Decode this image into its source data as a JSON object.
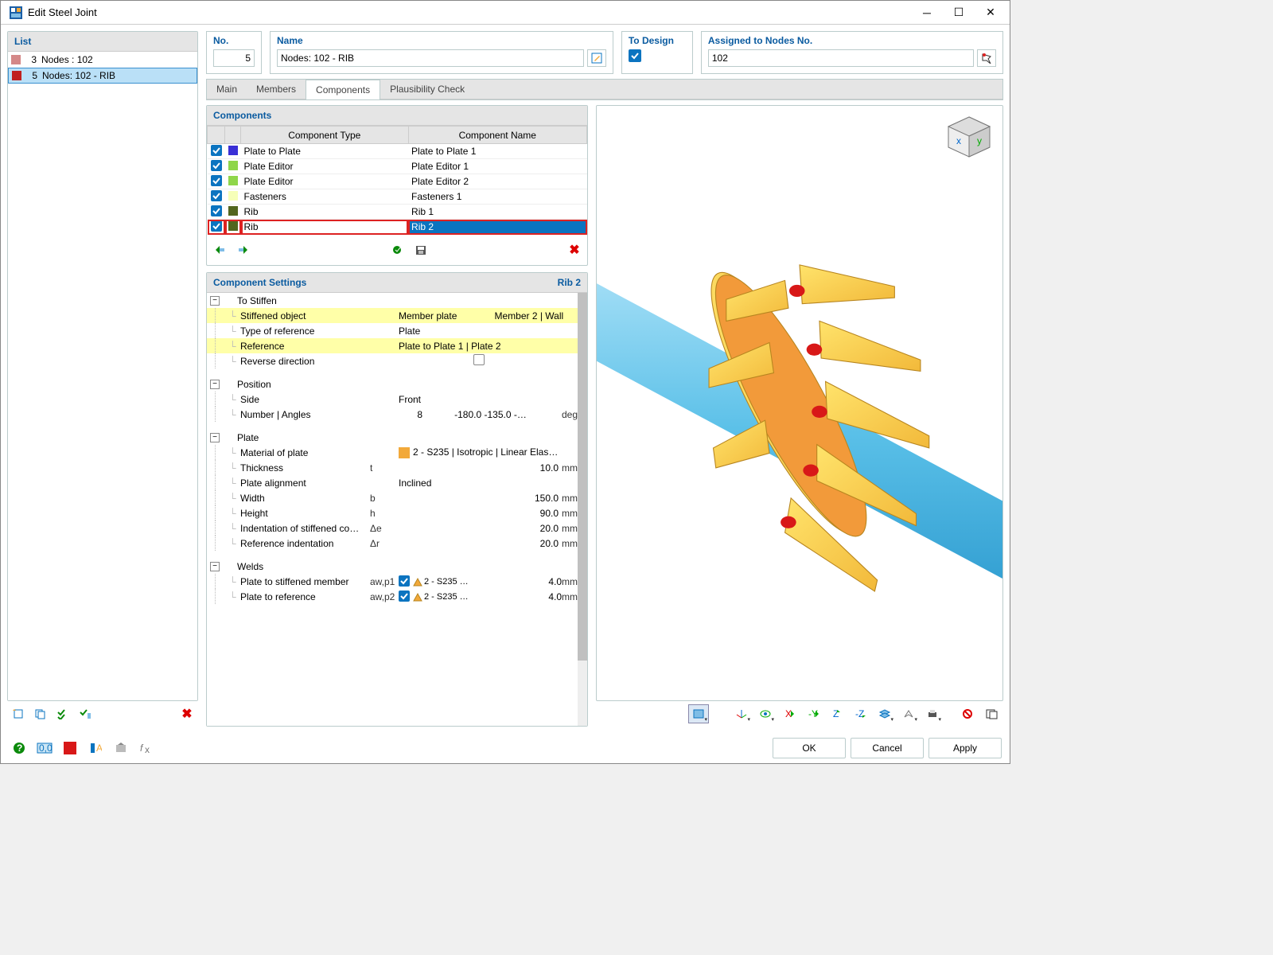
{
  "window": {
    "title": "Edit Steel Joint"
  },
  "list": {
    "header": "List",
    "items": [
      {
        "num": "3",
        "label": "Nodes : 102",
        "color": "#d48888",
        "selected": false
      },
      {
        "num": "5",
        "label": "Nodes: 102 - RIB",
        "color": "#c02020",
        "selected": true
      }
    ]
  },
  "header": {
    "no_label": "No.",
    "no_value": "5",
    "name_label": "Name",
    "name_value": "Nodes: 102 - RIB",
    "design_label": "To Design",
    "assigned_label": "Assigned to Nodes No.",
    "assigned_value": "102"
  },
  "tabs": {
    "items": [
      "Main",
      "Members",
      "Components",
      "Plausibility Check"
    ],
    "active": 2
  },
  "components": {
    "header": "Components",
    "cols": {
      "type": "Component Type",
      "name": "Component Name"
    },
    "rows": [
      {
        "color": "#3a2fd6",
        "type": "Plate to Plate",
        "name": "Plate to Plate 1"
      },
      {
        "color": "#8fd64a",
        "type": "Plate Editor",
        "name": "Plate Editor 1"
      },
      {
        "color": "#8fd64a",
        "type": "Plate Editor",
        "name": "Plate Editor 2"
      },
      {
        "color": "#f6ffb8",
        "type": "Fasteners",
        "name": "Fasteners 1"
      },
      {
        "color": "#52661e",
        "type": "Rib",
        "name": "Rib 1"
      },
      {
        "color": "#52661e",
        "type": "Rib",
        "name": "Rib 2",
        "selected": true
      }
    ]
  },
  "settings": {
    "header": "Component Settings",
    "current": "Rib 2",
    "groups": [
      {
        "name": "To Stiffen",
        "rows": [
          {
            "label": "Stiffened object",
            "val": "Member plate",
            "val2": "Member 2 | Wall",
            "hl": true
          },
          {
            "label": "Type of reference",
            "val": "Plate"
          },
          {
            "label": "Reference",
            "val": "Plate to Plate 1 | Plate  2",
            "hl": true
          },
          {
            "label": "Reverse direction",
            "checkbox": true
          }
        ]
      },
      {
        "name": "Position",
        "rows": [
          {
            "label": "Side",
            "val": "Front"
          },
          {
            "label": "Number | Angles",
            "num": "8",
            "val": "-180.0 -135.0 -…",
            "unit": "deg"
          }
        ]
      },
      {
        "name": "Plate",
        "rows": [
          {
            "label": "Material of plate",
            "mat": true,
            "val": "2 - S235 | Isotropic | Linear Elast…"
          },
          {
            "label": "Thickness",
            "sym": "t",
            "num": "10.0",
            "unit": "mm"
          },
          {
            "label": "Plate alignment",
            "val": "Inclined"
          },
          {
            "label": "Width",
            "sym": "b",
            "num": "150.0",
            "unit": "mm"
          },
          {
            "label": "Height",
            "sym": "h",
            "num": "90.0",
            "unit": "mm"
          },
          {
            "label": "Indentation of stiffened co…",
            "sym": "Δe",
            "num": "20.0",
            "unit": "mm"
          },
          {
            "label": "Reference indentation",
            "sym": "Δr",
            "num": "20.0",
            "unit": "mm"
          }
        ]
      },
      {
        "name": "Welds",
        "rows": [
          {
            "label": "Plate to stiffened member",
            "sym": "aw,p1",
            "weld": true,
            "wval": "2 - S235 …",
            "num": "4.0",
            "unit": "mm"
          },
          {
            "label": "Plate to reference",
            "sym": "aw,p2",
            "weld": true,
            "wval": "2 - S235 …",
            "num": "4.0",
            "unit": "mm"
          }
        ]
      }
    ]
  },
  "buttons": {
    "ok": "OK",
    "cancel": "Cancel",
    "apply": "Apply"
  }
}
